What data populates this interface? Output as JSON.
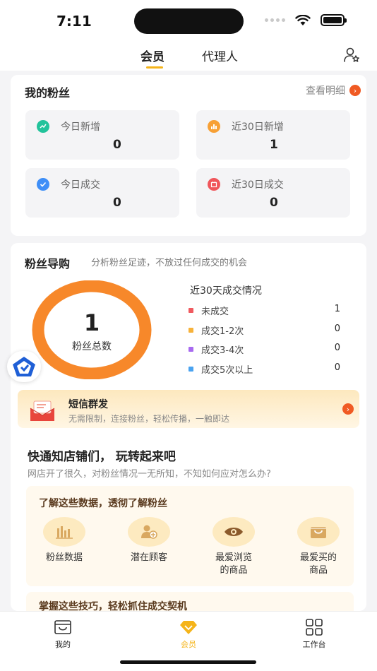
{
  "status_bar": {
    "time": "7:11"
  },
  "header": {
    "tabs": [
      {
        "label": "会员",
        "active": true
      },
      {
        "label": "代理人",
        "active": false
      }
    ],
    "right_icon": "user-star-icon"
  },
  "my_fans": {
    "title": "我的粉丝",
    "detail_link": "查看明细",
    "stats": [
      {
        "label": "今日新增",
        "value": "0",
        "icon": "trend-icon",
        "color": "#22c39b"
      },
      {
        "label": "近30日新增",
        "value": "1",
        "icon": "bar-chart-icon",
        "color": "#f7a035"
      },
      {
        "label": "今日成交",
        "value": "0",
        "icon": "check-icon",
        "color": "#3e8ef7"
      },
      {
        "label": "近30日成交",
        "value": "0",
        "icon": "calendar-icon",
        "color": "#f0565b"
      }
    ]
  },
  "fan_guide": {
    "title": "粉丝导购",
    "subtitle": "分析粉丝足迹，不放过任何成交的机会",
    "total": "1",
    "total_label": "粉丝总数",
    "legend_title": "近30天成交情况",
    "ring_color": "#f7882a",
    "legend": [
      {
        "name": "未成交",
        "value": "1",
        "color": "#f05a5f"
      },
      {
        "name": "成交1-2次",
        "value": "0",
        "color": "#f7b23a"
      },
      {
        "name": "成交3-4次",
        "value": "0",
        "color": "#a86af0"
      },
      {
        "name": "成交5次以上",
        "value": "0",
        "color": "#4aa3f0"
      }
    ]
  },
  "sms": {
    "title": "短信群发",
    "desc": "无需限制，连接粉丝，轻松传播，一触即达"
  },
  "promo": {
    "title": "快通知店铺们， 玩转起来吧",
    "subtitle": "网店开了很久，对粉丝情况一无所知，不知如何应对怎么办?",
    "data_panel_title": "了解这些数据，透彻了解粉丝",
    "features": [
      {
        "label": "粉丝数据",
        "icon": "bar-chart-icon"
      },
      {
        "label": "潜在顾客",
        "icon": "user-plus-icon"
      },
      {
        "label": "最爱浏览的商品",
        "icon": "eye-icon"
      },
      {
        "label": "最爱买的商品",
        "icon": "basket-icon"
      }
    ],
    "skills_title": "掌握这些技巧，轻松抓住成交契机"
  },
  "tabbar": {
    "items": [
      {
        "label": "我的",
        "icon": "store-icon",
        "active": false
      },
      {
        "label": "会员",
        "icon": "diamond-icon",
        "active": true
      },
      {
        "label": "工作台",
        "icon": "grid-icon",
        "active": false
      }
    ]
  }
}
